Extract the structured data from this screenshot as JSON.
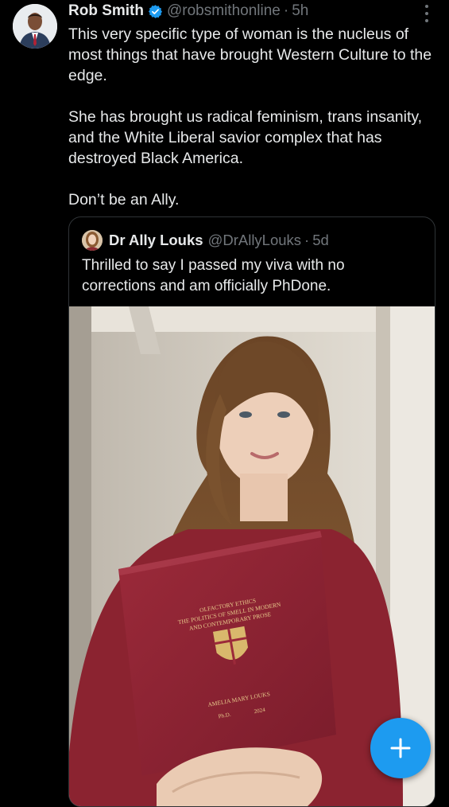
{
  "tweet": {
    "author_name": "Rob Smith",
    "author_handle": "@robsmithonline",
    "separator": "·",
    "time": "5h",
    "paragraphs": [
      "This very specific type of woman is the nucleus of most things that have brought Western Culture to the edge.",
      "She has brought us radical feminism, trans insanity, and the White Liberal savior complex that has destroyed Black America.",
      "Don’t be an Ally."
    ]
  },
  "quoted": {
    "author_name": "Dr Ally Louks",
    "author_handle": "@DrAllyLouks",
    "separator": "·",
    "time": "5d",
    "text": "Thrilled to say I passed my viva with no corrections and am officially PhDone.",
    "thesis_cover": {
      "title_lines": [
        "OLFACTORY ETHICS",
        "THE POLITICS OF SMELL IN MODERN",
        "AND CONTEMPORARY PROSE"
      ],
      "author": "AMELIA MARY LOUKS",
      "degree": "Ph.D.",
      "year": "2024"
    }
  },
  "icons": {
    "verified": "verified-badge-icon",
    "more": "more-options-icon",
    "compose": "compose-plus-icon"
  },
  "colors": {
    "background": "#000000",
    "text": "#e7e9ea",
    "muted": "#71767b",
    "accent": "#1d9bf0",
    "border": "#2f3336"
  }
}
